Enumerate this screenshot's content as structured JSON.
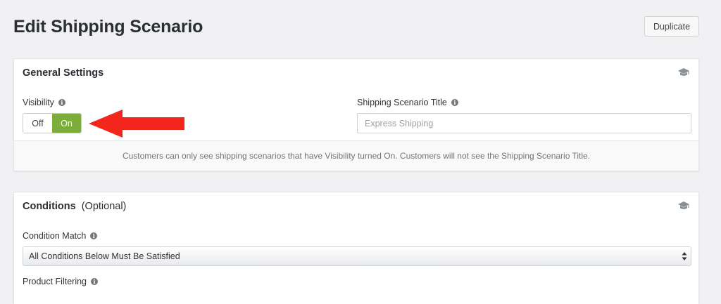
{
  "page": {
    "title": "Edit Shipping Scenario",
    "duplicate_label": "Duplicate"
  },
  "general": {
    "title": "General Settings",
    "visibility_label": "Visibility",
    "toggle": {
      "off_label": "Off",
      "on_label": "On",
      "selected": "On"
    },
    "scenario_title_label": "Shipping Scenario Title",
    "scenario_title_placeholder": "Express Shipping",
    "footer_note": "Customers can only see shipping scenarios that have Visibility turned On. Customers will not see the Shipping Scenario Title."
  },
  "conditions": {
    "title": "Conditions",
    "optional_label": "(Optional)",
    "condition_match_label": "Condition Match",
    "condition_match_value": "All Conditions Below Must Be Satisfied",
    "product_filtering_label": "Product Filtering"
  },
  "icons": {
    "info": "info-icon",
    "help": "graduation-cap-icon",
    "annotation_arrow": "red-arrow-icon"
  },
  "colors": {
    "toggle_on": "#7cac3a",
    "annotation_arrow": "#f2261d",
    "background": "#f1f1f3"
  }
}
